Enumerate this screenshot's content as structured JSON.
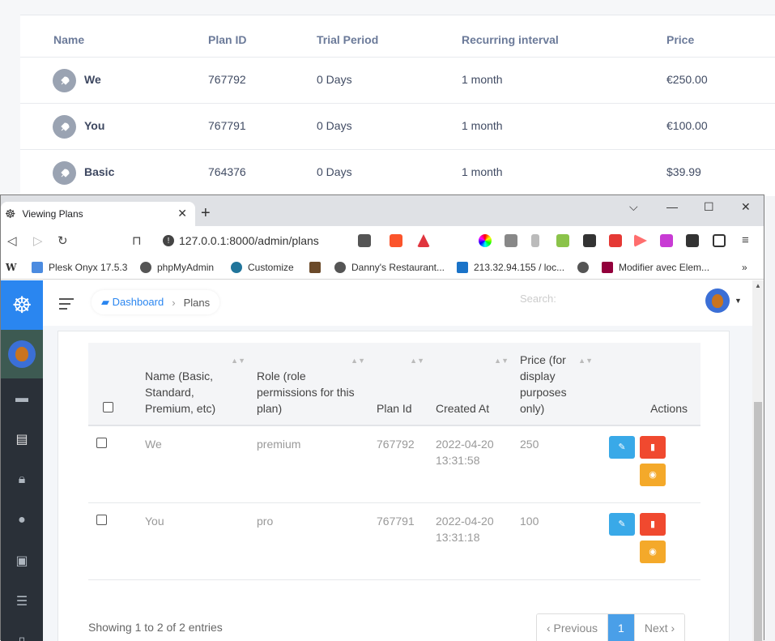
{
  "bg_table": {
    "headers": [
      "Name",
      "Plan ID",
      "Trial Period",
      "Recurring interval",
      "Price"
    ],
    "rows": [
      {
        "name": "We",
        "plan_id": "767792",
        "trial": "0 Days",
        "interval": "1 month",
        "price": "€250.00"
      },
      {
        "name": "You",
        "plan_id": "767791",
        "trial": "0 Days",
        "interval": "1 month",
        "price": "€100.00"
      },
      {
        "name": "Basic",
        "plan_id": "764376",
        "trial": "0 Days",
        "interval": "1 month",
        "price": "$39.99"
      }
    ]
  },
  "browser": {
    "tab_title": "Viewing Plans",
    "tab_close": "✕",
    "new_tab": "+",
    "url": "127.0.0.1:8000/admin/plans",
    "controls": {
      "menu": "⌵",
      "minimize": "—",
      "maximize": "☐",
      "close": "✕"
    },
    "bookmarks": [
      "Plesk Onyx 17.5.3",
      "phpMyAdmin",
      "Customize",
      "Danny's Restaurant...",
      "213.32.94.155 / loc...",
      "Modifier avec Elem..."
    ],
    "more": "»"
  },
  "admin": {
    "breadcrumb": {
      "home": "Dashboard",
      "current": "Plans"
    },
    "search_label": "Search:",
    "table": {
      "headers": {
        "name": "Name (Basic, Standard, Premium, etc)",
        "role": "Role (role permissions for this plan)",
        "plan_id": "Plan Id",
        "created": "Created At",
        "price": "Price (for display purposes only)",
        "actions": "Actions"
      },
      "rows": [
        {
          "name": "We",
          "role": "premium",
          "plan_id": "767792",
          "created": "2022-04-20 13:31:58",
          "price": "250"
        },
        {
          "name": "You",
          "role": "pro",
          "plan_id": "767791",
          "created": "2022-04-20 13:31:18",
          "price": "100"
        }
      ]
    },
    "info": "Showing 1 to 2 of 2 entries",
    "pagination": {
      "previous": "‹ Previous",
      "page": "1",
      "next": "Next ›"
    }
  }
}
